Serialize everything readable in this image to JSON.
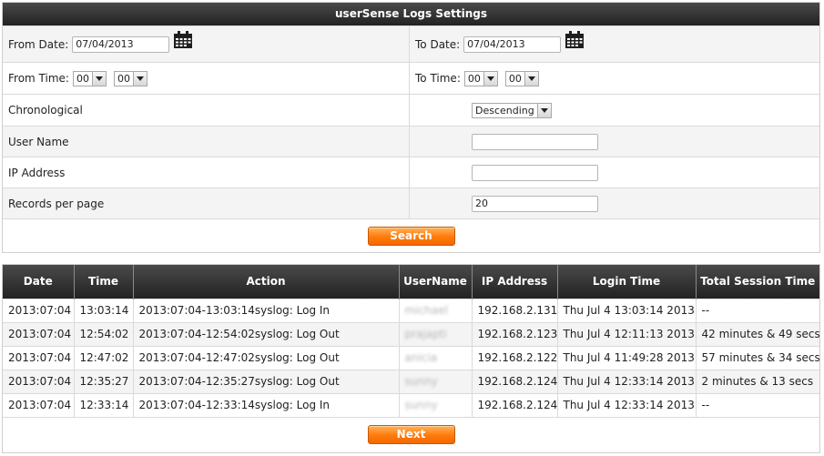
{
  "settings": {
    "title": "userSense Logs Settings",
    "from_date_label": "From Date:",
    "from_date_value": "07/04/2013",
    "to_date_label": "To Date:",
    "to_date_value": "07/04/2013",
    "from_time_label": "From Time:",
    "from_hour": "00",
    "from_minute": "00",
    "to_time_label": "To Time:",
    "to_hour": "00",
    "to_minute": "00",
    "chronological_label": "Chronological",
    "chronological_value": "Descending",
    "user_name_label": "User Name",
    "user_name_value": "",
    "ip_address_label": "IP Address",
    "ip_address_value": "",
    "records_label": "Records per page",
    "records_value": "20",
    "search_button": "Search"
  },
  "logs": {
    "columns": [
      "Date",
      "Time",
      "Action",
      "UserName",
      "IP Address",
      "Login Time",
      "Total Session Time"
    ],
    "rows": [
      {
        "date": "2013:07:04",
        "time": "13:03:14",
        "action": "2013:07:04-13:03:14syslog: Log In",
        "username": "michael",
        "ip": "192.168.2.131",
        "login_time": "Thu Jul 4 13:03:14 2013",
        "session": "--"
      },
      {
        "date": "2013:07:04",
        "time": "12:54:02",
        "action": "2013:07:04-12:54:02syslog: Log Out",
        "username": "prajapti",
        "ip": "192.168.2.123",
        "login_time": "Thu Jul 4 12:11:13 2013",
        "session": "42 minutes & 49 secs"
      },
      {
        "date": "2013:07:04",
        "time": "12:47:02",
        "action": "2013:07:04-12:47:02syslog: Log Out",
        "username": "anicia",
        "ip": "192.168.2.122",
        "login_time": "Thu Jul 4 11:49:28 2013",
        "session": "57 minutes & 34 secs"
      },
      {
        "date": "2013:07:04",
        "time": "12:35:27",
        "action": "2013:07:04-12:35:27syslog: Log Out",
        "username": "sunny",
        "ip": "192.168.2.124",
        "login_time": "Thu Jul 4 12:33:14 2013",
        "session": "2 minutes & 13 secs"
      },
      {
        "date": "2013:07:04",
        "time": "12:33:14",
        "action": "2013:07:04-12:33:14syslog: Log In",
        "username": "sunny",
        "ip": "192.168.2.124",
        "login_time": "Thu Jul 4 12:33:14 2013",
        "session": "--"
      }
    ],
    "next_button": "Next"
  },
  "icons": {
    "calendar": "calendar-icon",
    "dropdown": "chevron-down-icon"
  },
  "colors": {
    "header_dark": "#222222",
    "button_orange": "#ff7a0a",
    "row_shade": "#f4f4f4"
  }
}
